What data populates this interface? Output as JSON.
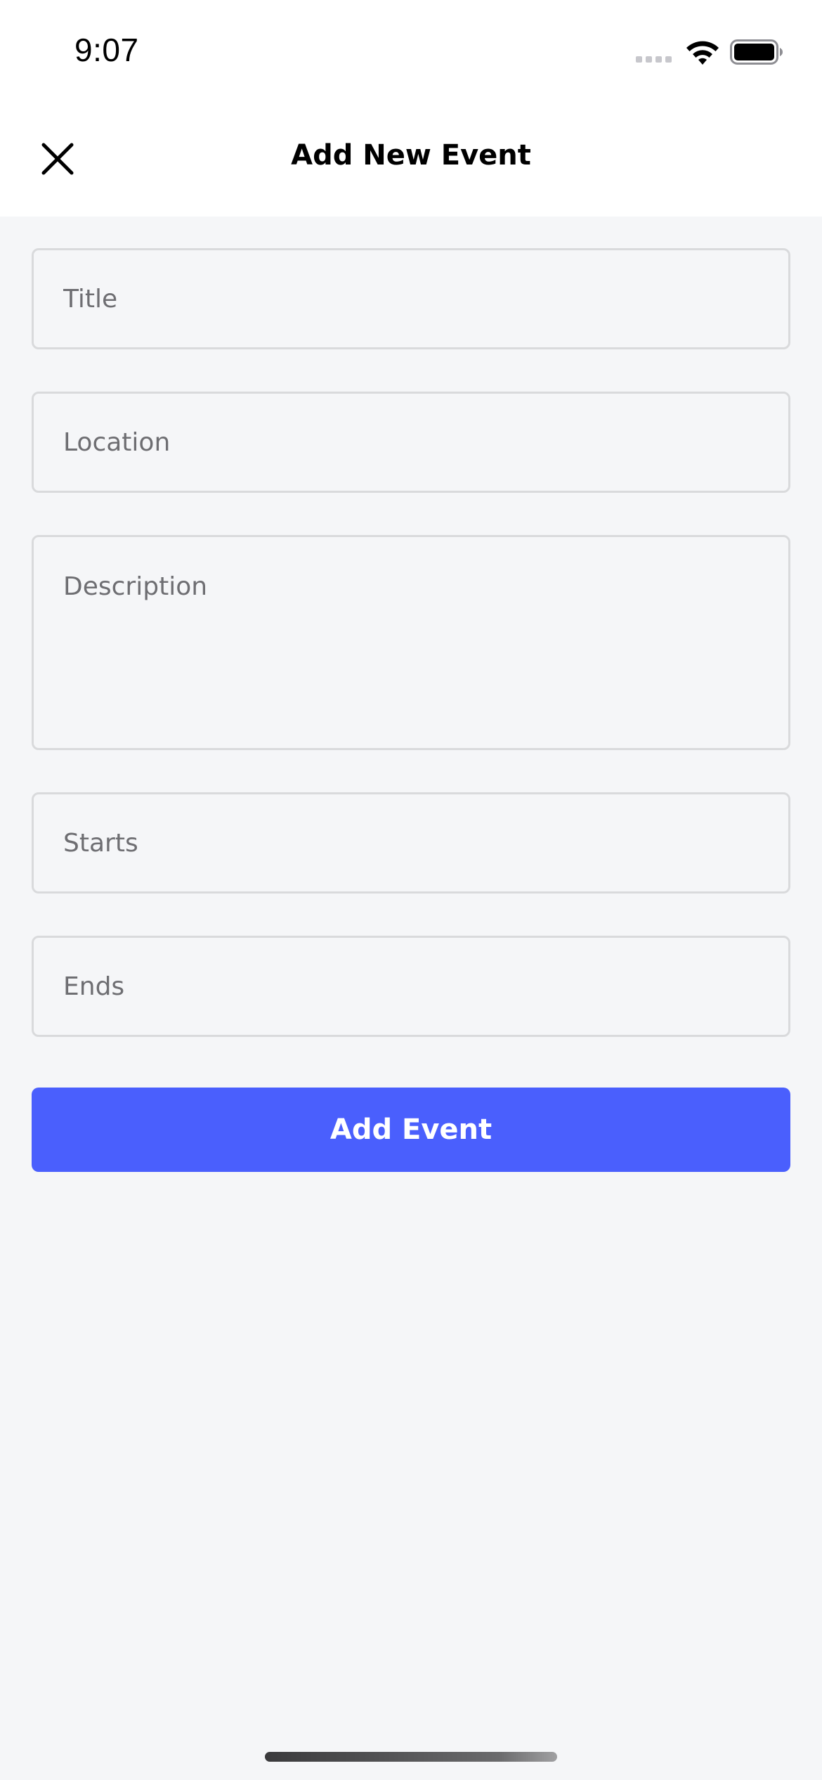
{
  "status_bar": {
    "time": "9:07",
    "icons": [
      "signal-icon",
      "wifi-icon",
      "battery-icon"
    ]
  },
  "header": {
    "title": "Add New Event",
    "close_icon": "close-icon"
  },
  "form": {
    "title": {
      "placeholder": "Title",
      "value": ""
    },
    "location": {
      "placeholder": "Location",
      "value": ""
    },
    "description": {
      "placeholder": "Description",
      "value": ""
    },
    "starts": {
      "placeholder": "Starts",
      "value": ""
    },
    "ends": {
      "placeholder": "Ends",
      "value": ""
    },
    "submit_label": "Add Event"
  },
  "colors": {
    "accent": "#4a5ffd",
    "background": "#f5f6f8",
    "field_border": "#d9dadc"
  }
}
